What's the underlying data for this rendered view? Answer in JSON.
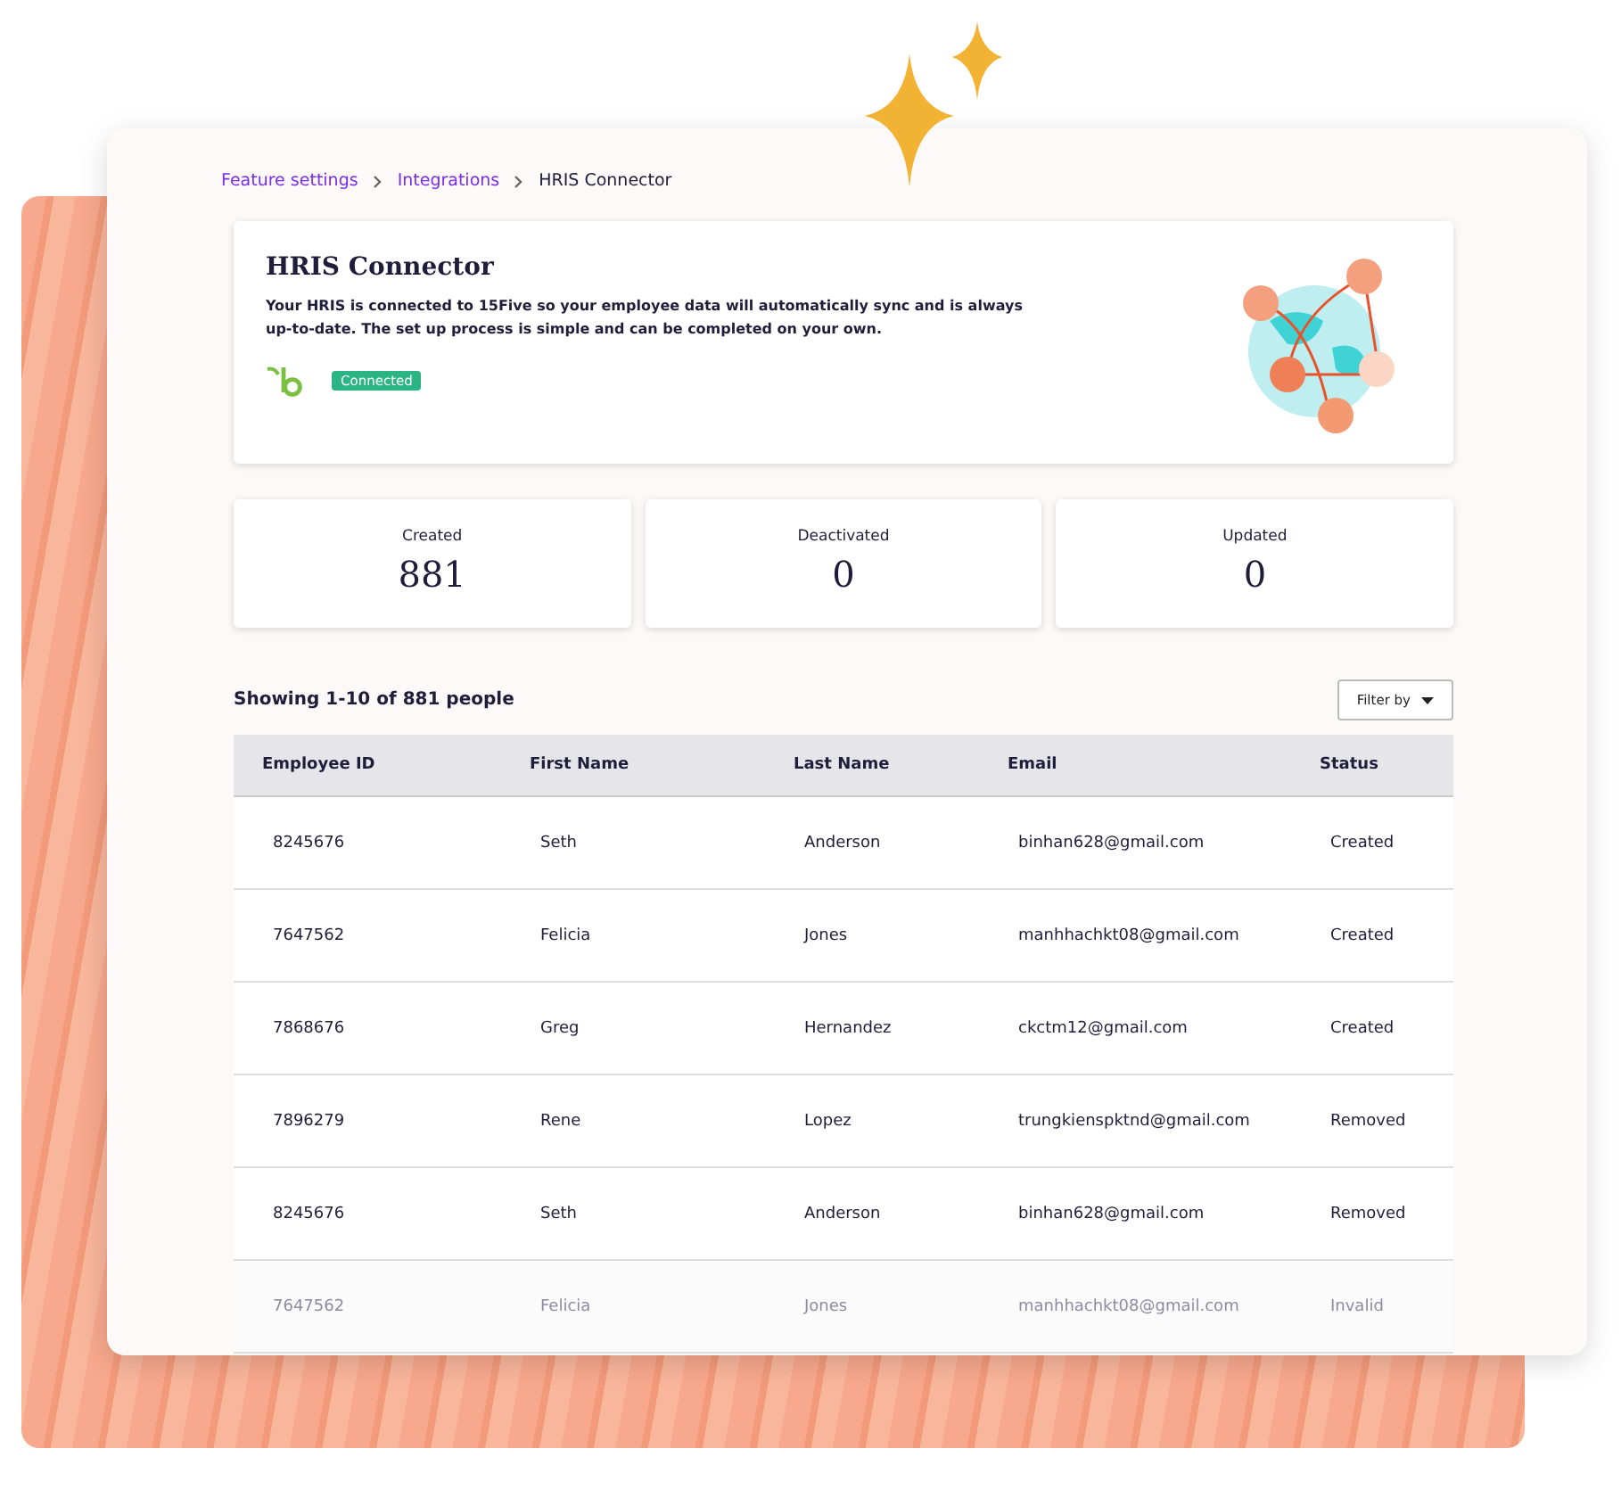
{
  "breadcrumb": [
    {
      "label": "Feature settings",
      "link": true
    },
    {
      "label": "Integrations",
      "link": true
    },
    {
      "label": "HRIS Connector",
      "link": false
    }
  ],
  "connector": {
    "title": "HRIS Connector",
    "description": "Your HRIS is connected to  15Five so your employee data will automatically sync and is always up-to-date. The set up process is simple and can be completed on your own.",
    "status": "Connected"
  },
  "stats": [
    {
      "label": "Created",
      "value": "881"
    },
    {
      "label": "Deactivated",
      "value": "0"
    },
    {
      "label": "Updated",
      "value": "0"
    }
  ],
  "table": {
    "summary": "Showing 1-10 of 881 people",
    "filter": "Filter by",
    "columns": [
      "Employee ID",
      "First Name",
      "Last Name",
      "Email",
      "Status"
    ],
    "rows": [
      {
        "cells": [
          "8245676",
          "Seth",
          "Anderson",
          "binhan628@gmail.com",
          "Created"
        ],
        "faded": false
      },
      {
        "cells": [
          "7647562",
          "Felicia",
          "Jones",
          "manhhachkt08@gmail.com",
          "Created"
        ],
        "faded": false
      },
      {
        "cells": [
          "7868676",
          "Greg",
          "Hernandez",
          "ckctm12@gmail.com",
          "Created"
        ],
        "faded": false
      },
      {
        "cells": [
          "7896279",
          "Rene",
          "Lopez",
          "trungkienspktnd@gmail.com",
          "Removed"
        ],
        "faded": false
      },
      {
        "cells": [
          "8245676",
          "Seth",
          "Anderson",
          "binhan628@gmail.com",
          "Removed"
        ],
        "faded": false
      },
      {
        "cells": [
          "7647562",
          "Felicia",
          "Jones",
          "manhhachkt08@gmail.com",
          "Invalid"
        ],
        "faded": true
      }
    ]
  }
}
